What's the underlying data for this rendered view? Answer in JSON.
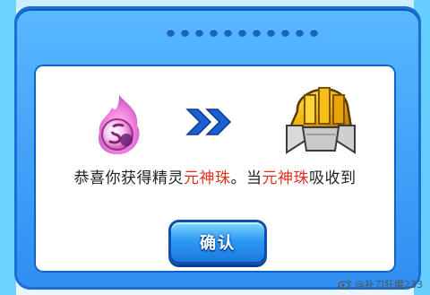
{
  "dialog": {
    "message_prefix": "恭喜你获得精灵",
    "item_name": "元神珠",
    "message_middle": "。当",
    "item_name_2": "元神珠",
    "message_suffix": "吸收到",
    "confirm_label": "确认"
  },
  "icons": {
    "left": "spirit-orb-icon",
    "middle": "double-chevron-right-icon",
    "right": "golden-armor-icon"
  },
  "watermark": {
    "text": "@补刀狂魔233"
  },
  "colors": {
    "frame_blue": "#2f8ef2",
    "highlight_red": "#e0301e",
    "chevron_blue": "#1b5fd0"
  }
}
